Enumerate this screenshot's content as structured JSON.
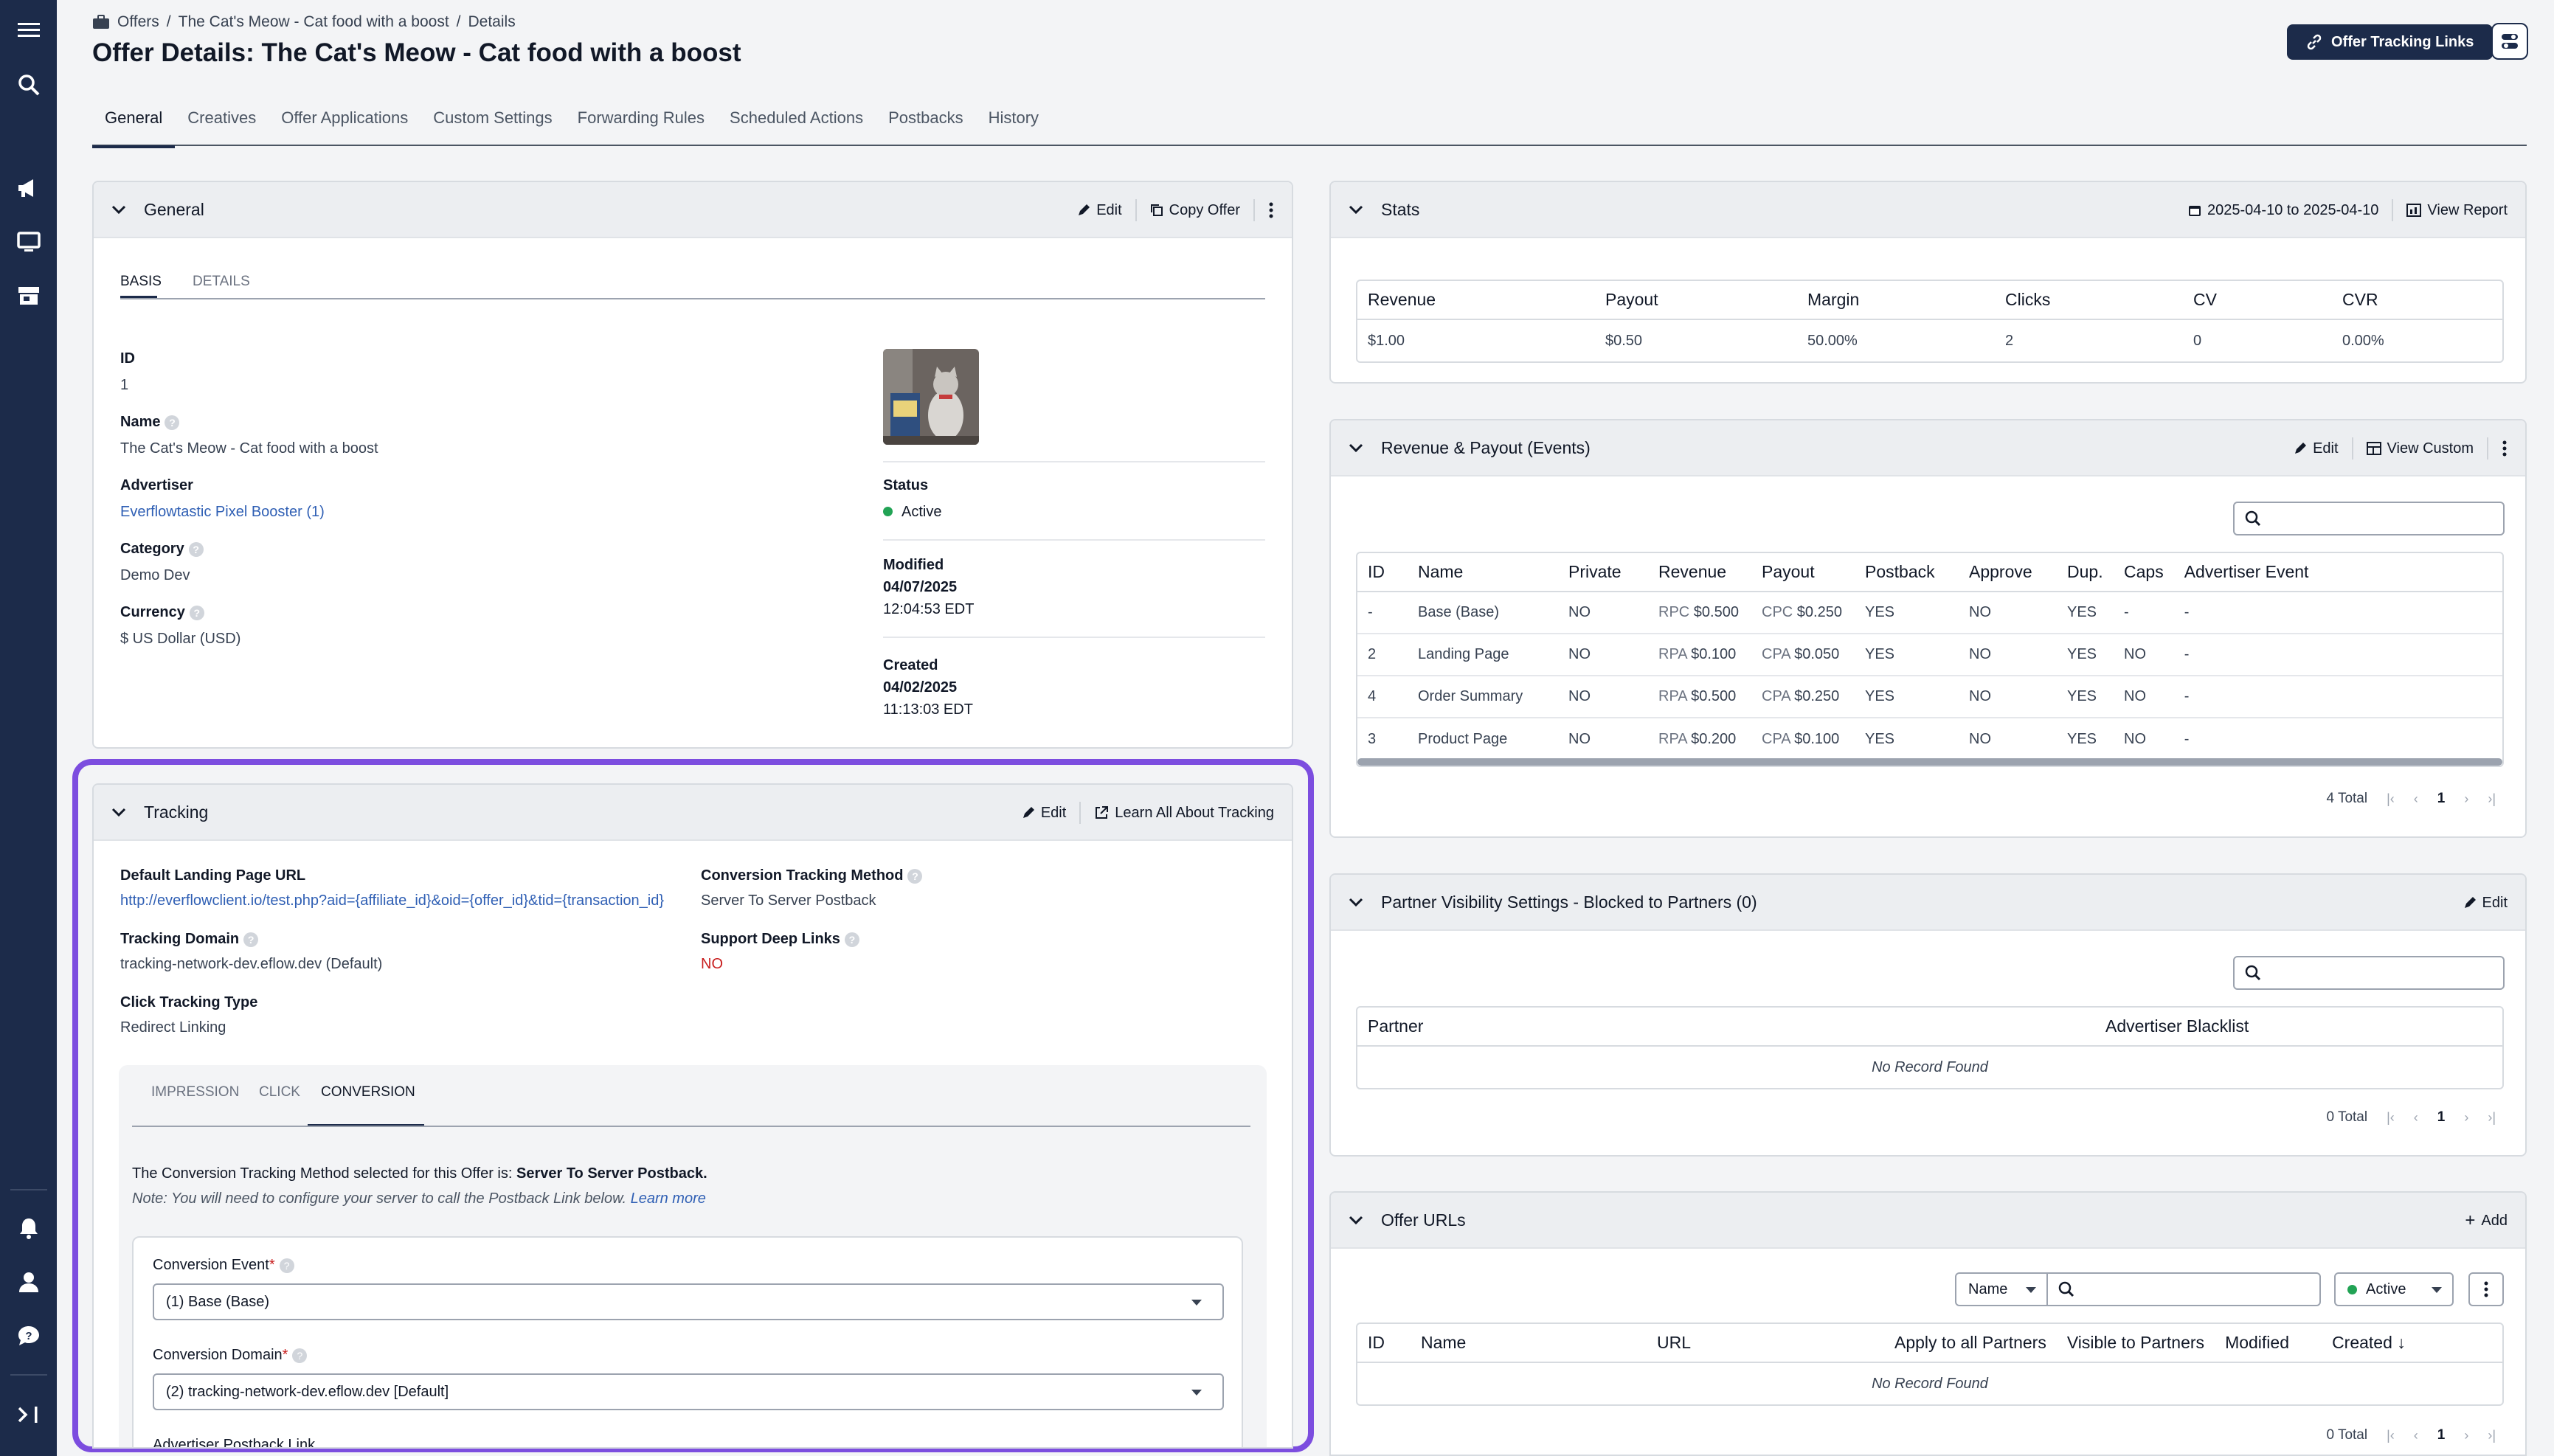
{
  "breadcrumb": {
    "offers": "Offers",
    "offer": "The Cat's Meow - Cat food with a boost",
    "current": "Details"
  },
  "page_title": "Offer Details: The Cat's Meow - Cat food with a boost",
  "header": {
    "tracking_links": "Offer Tracking Links"
  },
  "tabs": [
    "General",
    "Creatives",
    "Offer Applications",
    "Custom Settings",
    "Forwarding Rules",
    "Scheduled Actions",
    "Postbacks",
    "History"
  ],
  "general": {
    "title": "General",
    "edit": "Edit",
    "copy": "Copy Offer",
    "subtabs": [
      "BASIS",
      "DETAILS"
    ],
    "id_label": "ID",
    "id": "1",
    "name_label": "Name",
    "name": "The Cat's Meow - Cat food with a boost",
    "advertiser_label": "Advertiser",
    "advertiser": "Everflowtastic Pixel Booster (1)",
    "category_label": "Category",
    "category": "Demo Dev",
    "currency_label": "Currency",
    "currency": "$ US Dollar (USD)",
    "status_label": "Status",
    "status": "Active",
    "modified_label": "Modified",
    "modified_date": "04/07/2025",
    "modified_time": "12:04:53 EDT",
    "created_label": "Created",
    "created_date": "04/02/2025",
    "created_time": "11:13:03 EDT"
  },
  "tracking": {
    "title": "Tracking",
    "edit": "Edit",
    "learn": "Learn All About Tracking",
    "landing_label": "Default Landing Page URL",
    "landing": "http://everflowclient.io/test.php?aid={affiliate_id}&oid={offer_id}&tid={transaction_id}",
    "method_label": "Conversion Tracking Method",
    "method": "Server To Server Postback",
    "domain_label": "Tracking Domain",
    "domain": "tracking-network-dev.eflow.dev (Default)",
    "deep_label": "Support Deep Links",
    "deep": "NO",
    "click_label": "Click Tracking Type",
    "click": "Redirect Linking",
    "subtabs": [
      "IMPRESSION",
      "CLICK",
      "CONVERSION"
    ],
    "note_prefix": "The Conversion Tracking Method selected for this Offer is: ",
    "note_method": "Server To Server Postback.",
    "note2": "Note: You will need to configure your server to call the Postback Link below. ",
    "learn_more": "Learn more",
    "event_label": "Conversion Event",
    "event": "(1) Base (Base)",
    "cdomain_label": "Conversion Domain",
    "cdomain": "(2) tracking-network-dev.eflow.dev [Default]",
    "pb_label": "Advertiser Postback Link",
    "req": "*"
  },
  "stats": {
    "title": "Stats",
    "range": "2025-04-10 to 2025-04-10",
    "view": "View Report",
    "headers": [
      "Revenue",
      "Payout",
      "Margin",
      "Clicks",
      "CV",
      "CVR"
    ],
    "values": [
      "$1.00",
      "$0.50",
      "50.00%",
      "2",
      "0",
      "0.00%"
    ]
  },
  "revpay": {
    "title": "Revenue & Payout (Events)",
    "edit": "Edit",
    "view": "View Custom",
    "headers": [
      "ID",
      "Name",
      "Private",
      "Revenue",
      "Payout",
      "Postback",
      "Approve",
      "Dup.",
      "Caps",
      "Advertiser Event"
    ],
    "rows": [
      {
        "id": "-",
        "name": "Base (Base)",
        "private": "NO",
        "rev_type": "RPC",
        "rev": "$0.500",
        "pay_type": "CPC",
        "pay": "$0.250",
        "postback": "YES",
        "approve": "NO",
        "dup": "YES",
        "caps": "-",
        "adv": "-"
      },
      {
        "id": "2",
        "name": "Landing Page",
        "private": "NO",
        "rev_type": "RPA",
        "rev": "$0.100",
        "pay_type": "CPA",
        "pay": "$0.050",
        "postback": "YES",
        "approve": "NO",
        "dup": "YES",
        "caps": "NO",
        "adv": "-"
      },
      {
        "id": "4",
        "name": "Order Summary",
        "private": "NO",
        "rev_type": "RPA",
        "rev": "$0.500",
        "pay_type": "CPA",
        "pay": "$0.250",
        "postback": "YES",
        "approve": "NO",
        "dup": "YES",
        "caps": "NO",
        "adv": "-"
      },
      {
        "id": "3",
        "name": "Product Page",
        "private": "NO",
        "rev_type": "RPA",
        "rev": "$0.200",
        "pay_type": "CPA",
        "pay": "$0.100",
        "postback": "YES",
        "approve": "NO",
        "dup": "YES",
        "caps": "NO",
        "adv": "-"
      }
    ],
    "total": "4 Total",
    "page": "1"
  },
  "visibility": {
    "title": "Partner Visibility Settings - Blocked to Partners (0)",
    "edit": "Edit",
    "headers": [
      "Partner",
      "Advertiser Blacklist"
    ],
    "empty": "No Record Found",
    "total": "0 Total",
    "page": "1"
  },
  "urls": {
    "title": "Offer URLs",
    "add": "Add",
    "filter": "Name",
    "status": "Active",
    "headers": [
      "ID",
      "Name",
      "URL",
      "Apply to all Partners",
      "Visible to Partners",
      "Modified",
      "Created"
    ],
    "empty": "No Record Found",
    "total": "0 Total",
    "page": "1"
  },
  "colors": {
    "nav": "#1c2b4a",
    "highlight": "#7c4ddf",
    "link": "#2f5fb4",
    "no": "#c81e1e",
    "yes": "#166534"
  }
}
